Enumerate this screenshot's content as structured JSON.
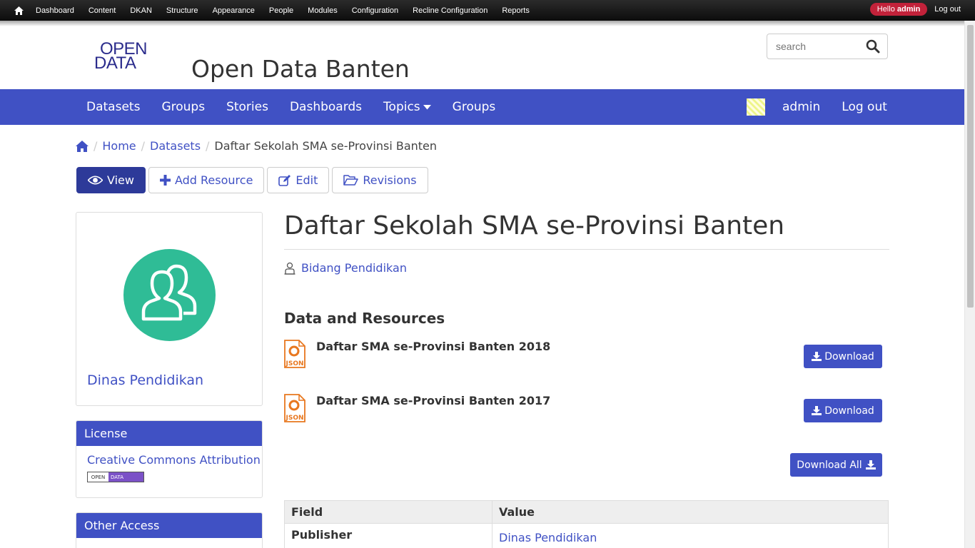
{
  "admin_bar": {
    "items": [
      "Dashboard",
      "Content",
      "DKAN",
      "Structure",
      "Appearance",
      "People",
      "Modules",
      "Configuration",
      "Recline Configuration",
      "Reports"
    ],
    "hello_prefix": "Hello",
    "hello_user": "admin",
    "logout": "Log out"
  },
  "header": {
    "logo_line1": "OPEN",
    "logo_line2": "DATA",
    "site_name": "Open Data Banten",
    "search_placeholder": "search"
  },
  "main_nav": {
    "items": [
      "Datasets",
      "Groups",
      "Stories",
      "Dashboards",
      "Topics",
      "Groups"
    ],
    "user": "admin",
    "logout": "Log out"
  },
  "breadcrumb": {
    "items": [
      "Home",
      "Datasets"
    ],
    "current": "Daftar Sekolah SMA se-Provinsi Banten"
  },
  "tabs": [
    "View",
    "Add Resource",
    "Edit",
    "Revisions"
  ],
  "sidebar": {
    "org_name": "Dinas Pendidikan",
    "license_heading": "License",
    "license_name": "Creative Commons Attribution",
    "license_badge_left": "OPEN",
    "license_badge_right": "DATA",
    "other_access_heading": "Other Access"
  },
  "content": {
    "title": "Daftar Sekolah SMA se-Provinsi Banten",
    "group": "Bidang Pendidikan",
    "resources_heading": "Data and Resources",
    "resources": [
      {
        "name": "Daftar SMA se-Provinsi Banten 2018",
        "format": "JSON",
        "button": "Download"
      },
      {
        "name": "Daftar SMA se-Provinsi Banten 2017",
        "format": "JSON",
        "button": "Download"
      }
    ],
    "download_all": "Download All",
    "table": {
      "headers": [
        "Field",
        "Value"
      ],
      "rows": [
        {
          "field": "Publisher",
          "value": "Dinas Pendidikan"
        }
      ]
    }
  },
  "colors": {
    "primary": "#4051c4",
    "primary_dark": "#2d3a99",
    "org_avatar": "#2fbc96",
    "json_icon": "#e8771f",
    "admin_hello": "#c2223a"
  }
}
